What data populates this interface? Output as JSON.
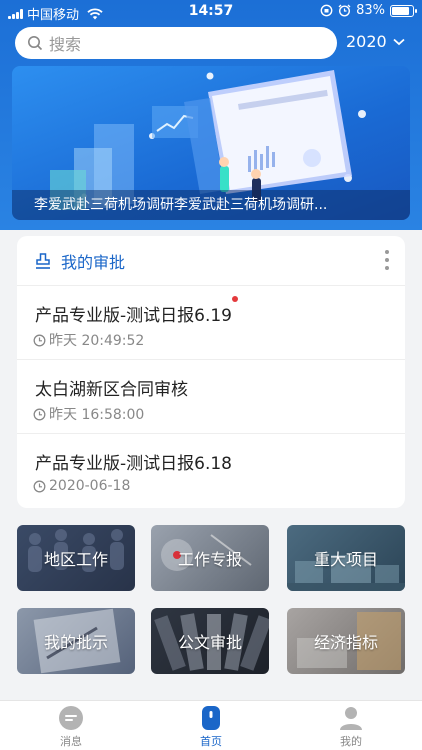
{
  "status_bar": {
    "carrier": "中国移动",
    "time": "14:57",
    "battery": "83%",
    "battery_level": 0.83
  },
  "header": {
    "search_placeholder": "搜索",
    "year": "2020"
  },
  "banner": {
    "caption": "李爱武赴三荷机场调研李爱武赴三荷机场调研..."
  },
  "approvals": {
    "title": "我的审批",
    "items": [
      {
        "title": "产品专业版-测试日报6.19",
        "time": "昨天 20:49:52",
        "unread": true
      },
      {
        "title": "太白湖新区合同审核",
        "time": "昨天 16:58:00",
        "unread": false
      },
      {
        "title": "产品专业版-测试日报6.18",
        "time": "2020-06-18",
        "unread": false
      }
    ]
  },
  "tiles": [
    {
      "label": "地区工作"
    },
    {
      "label": "工作专报"
    },
    {
      "label": "重大项目"
    },
    {
      "label": "我的批示"
    },
    {
      "label": "公文审批"
    },
    {
      "label": "经济指标"
    }
  ],
  "tab_bar": {
    "tabs": [
      {
        "label": "消息",
        "icon": "message-icon"
      },
      {
        "label": "首页",
        "icon": "home-icon",
        "active": true
      },
      {
        "label": "我的",
        "icon": "user-icon"
      }
    ]
  },
  "colors": {
    "brand": "#1a66c8",
    "header_blue": "#1c6fd6",
    "unread_dot": "#e4393c"
  }
}
